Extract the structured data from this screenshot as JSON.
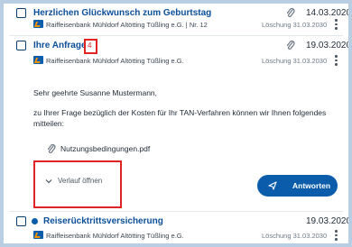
{
  "messages": [
    {
      "title": "Herzlichen Glückwunsch zum Geburtstag",
      "date": "14.03.2020",
      "bank": "Raiffeisenbank Mühldorf Altötting Tüßling e.G. | Nr. 12",
      "deletion": "Löschung 31.03.2030"
    },
    {
      "title": "Ihre Anfrage",
      "badge": "4",
      "date": "19.03.2020",
      "bank": "Raiffeisenbank Mühldorf Altötting Tüßling e.G.",
      "deletion": "Löschung 31.03.2030",
      "greeting": "Sehr geehrte Susanne Mustermann,",
      "body_line1": "zu Ihrer Frage bezüglich der Kosten für Ihr TAN-Verfahren können wir Ihnen folgendes",
      "body_line2": "mitteilen:",
      "attachment": "Nutzungsbedingungen.pdf",
      "expand_label": "Verlauf öffnen",
      "reply_label": "Antworten"
    },
    {
      "title": "Reiserücktrittsversicherung",
      "date": "19.03.2020",
      "bank": "Raiffeisenbank Mühldorf Altötting Tüßling e.G.",
      "deletion": "Löschung 31.03.2030"
    }
  ],
  "colors": {
    "accent": "#0b5cab",
    "title": "#0b4f9a",
    "highlight": "#e02424",
    "frame": "#b9cde3"
  }
}
